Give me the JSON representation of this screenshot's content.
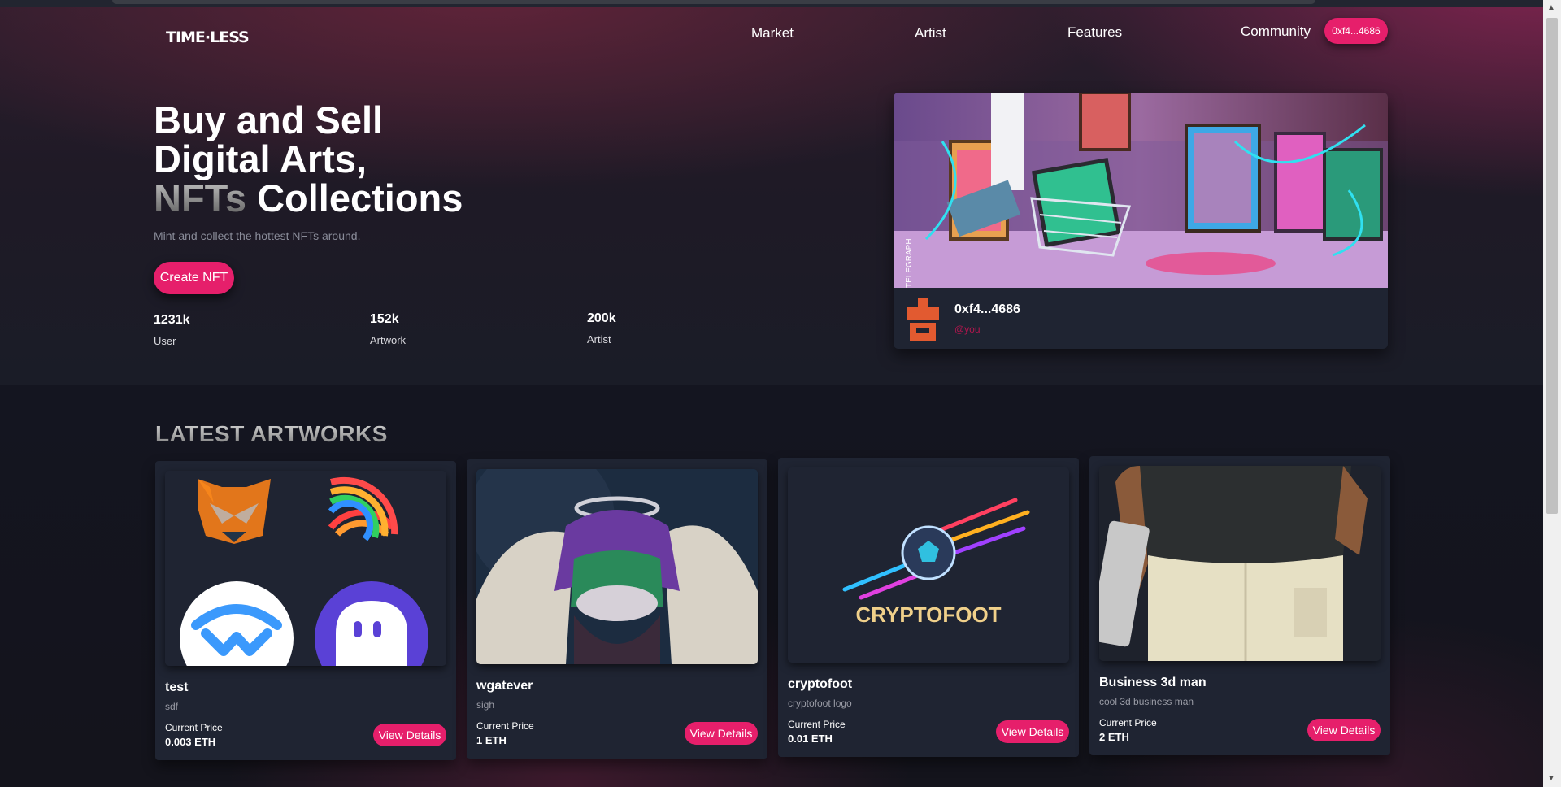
{
  "brand": {
    "logo": "TIME·LESS"
  },
  "nav": {
    "items": [
      "Market",
      "Artist",
      "Features",
      "Community"
    ],
    "wallet": "0xf4...4686"
  },
  "hero": {
    "title_line1": "Buy and Sell",
    "title_line2": "Digital Arts,",
    "title_muted": "NFTs",
    "title_rest": " Collections",
    "subtitle": "Mint and collect the hottest NFTs around.",
    "cta": "Create NFT",
    "stats": [
      {
        "value": "1231k",
        "label": "User"
      },
      {
        "value": "152k",
        "label": "Artwork"
      },
      {
        "value": "200k",
        "label": "Artist"
      }
    ],
    "featured": {
      "name": "0xf4...4686",
      "handle": "@you",
      "watermark": "TELEGRAPH"
    }
  },
  "latest": {
    "title": "LATEST ARTWORKS",
    "price_label": "Current Price",
    "button_label": "View Details",
    "cards": [
      {
        "title": "test",
        "desc": "sdf",
        "price": "0.003 ETH",
        "art": "wallet-logos-image"
      },
      {
        "title": "wgatever",
        "desc": "sigh",
        "price": "1 ETH",
        "art": "angel-gorilla-image"
      },
      {
        "title": "cryptofoot",
        "desc": "cryptofoot logo",
        "price": "0.01 ETH",
        "art": "cryptofoot-logo-image",
        "logo_text": "CRYPTOFOOT"
      },
      {
        "title": "Business 3d man",
        "desc": "cool 3d business man",
        "price": "2 ETH",
        "art": "business-man-image"
      }
    ]
  },
  "colors": {
    "accent": "#e61f6b",
    "card": "#1f2432",
    "handle": "#b3164e"
  }
}
